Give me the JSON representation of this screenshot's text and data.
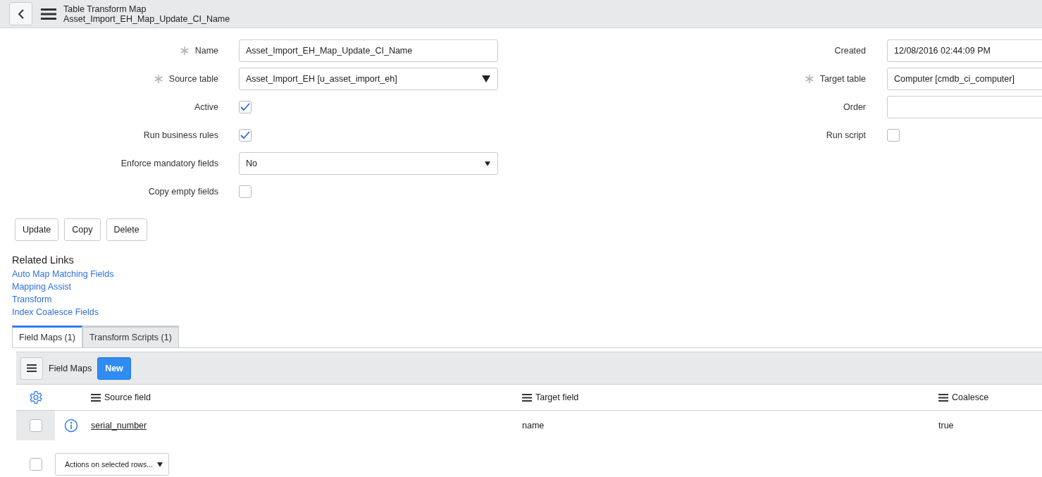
{
  "header": {
    "title": "Table Transform Map",
    "subtitle": "Asset_Import_EH_Map_Update_CI_Name"
  },
  "left_fields": [
    {
      "label": "Name",
      "required": true,
      "kind": "text",
      "value": "Asset_Import_EH_Map_Update_CI_Name"
    },
    {
      "label": "Source table",
      "required": true,
      "kind": "select",
      "value": "Asset_Import_EH [u_asset_import_eh]"
    },
    {
      "label": "Active",
      "required": false,
      "kind": "checkbox",
      "checked": true
    },
    {
      "label": "Run business rules",
      "required": false,
      "kind": "checkbox",
      "checked": true
    },
    {
      "label": "Enforce mandatory fields",
      "required": false,
      "kind": "dropdown",
      "value": "No"
    },
    {
      "label": "Copy empty fields",
      "required": false,
      "kind": "checkbox",
      "checked": false
    }
  ],
  "right_fields": [
    {
      "label": "Created",
      "required": false,
      "kind": "text",
      "value": "12/08/2016 02:44:09 PM"
    },
    {
      "label": "Target table",
      "required": true,
      "kind": "text",
      "value": "Computer [cmdb_ci_computer]"
    },
    {
      "label": "Order",
      "required": false,
      "kind": "text"
    },
    {
      "label": "Run script",
      "required": false,
      "kind": "checkbox",
      "checked": false
    }
  ],
  "buttons": [
    "Update",
    "Copy",
    "Delete"
  ],
  "related_links": {
    "title": "Related Links",
    "links": [
      "Auto Map Matching Fields",
      "Mapping Assist",
      "Transform",
      "Index Coalesce Fields"
    ]
  },
  "tabs": [
    {
      "label": "Field Maps (1)",
      "selected": true
    },
    {
      "label": "Transform Scripts (1)",
      "selected": false
    }
  ],
  "list": {
    "title": "Field Maps",
    "new_button": "New",
    "columns": [
      "Source field",
      "Target field",
      "Coalesce"
    ],
    "rows": [
      {
        "checked": false,
        "cells": [
          "serial_number",
          "name",
          "true"
        ]
      }
    ],
    "actions": {
      "checked": false,
      "placeholder": "Actions on selected rows..."
    }
  }
}
